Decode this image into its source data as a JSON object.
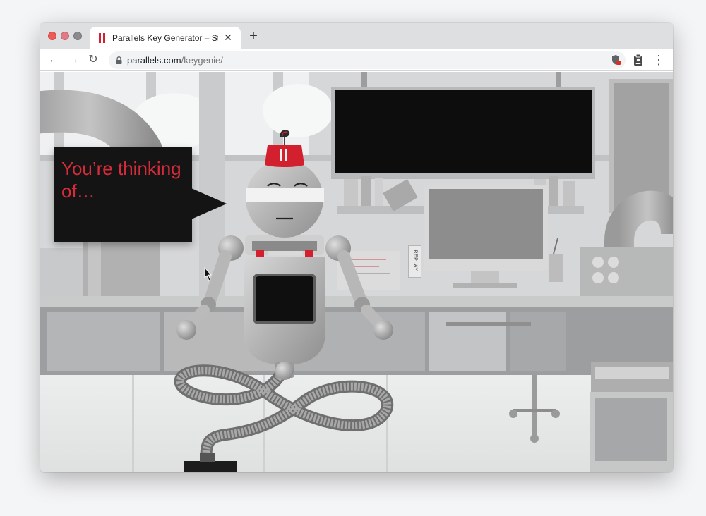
{
  "browser": {
    "tab": {
      "title": "Parallels Key Generator – Stum",
      "close_glyph": "✕",
      "favicon": "parallels-logo-icon"
    },
    "new_tab_glyph": "+",
    "nav": {
      "back_glyph": "←",
      "forward_glyph": "→",
      "reload_glyph": "↻"
    },
    "url": {
      "host": "parallels.com",
      "path": "/keygenie/"
    },
    "menu_glyph": "⋮"
  },
  "scene": {
    "speech_bubble": "You’re thinking of…",
    "replay_label": "REPLAY"
  },
  "colors": {
    "brand_red": "#d3202f",
    "bubble_bg": "#141414",
    "bubble_text": "#d62b3a"
  }
}
